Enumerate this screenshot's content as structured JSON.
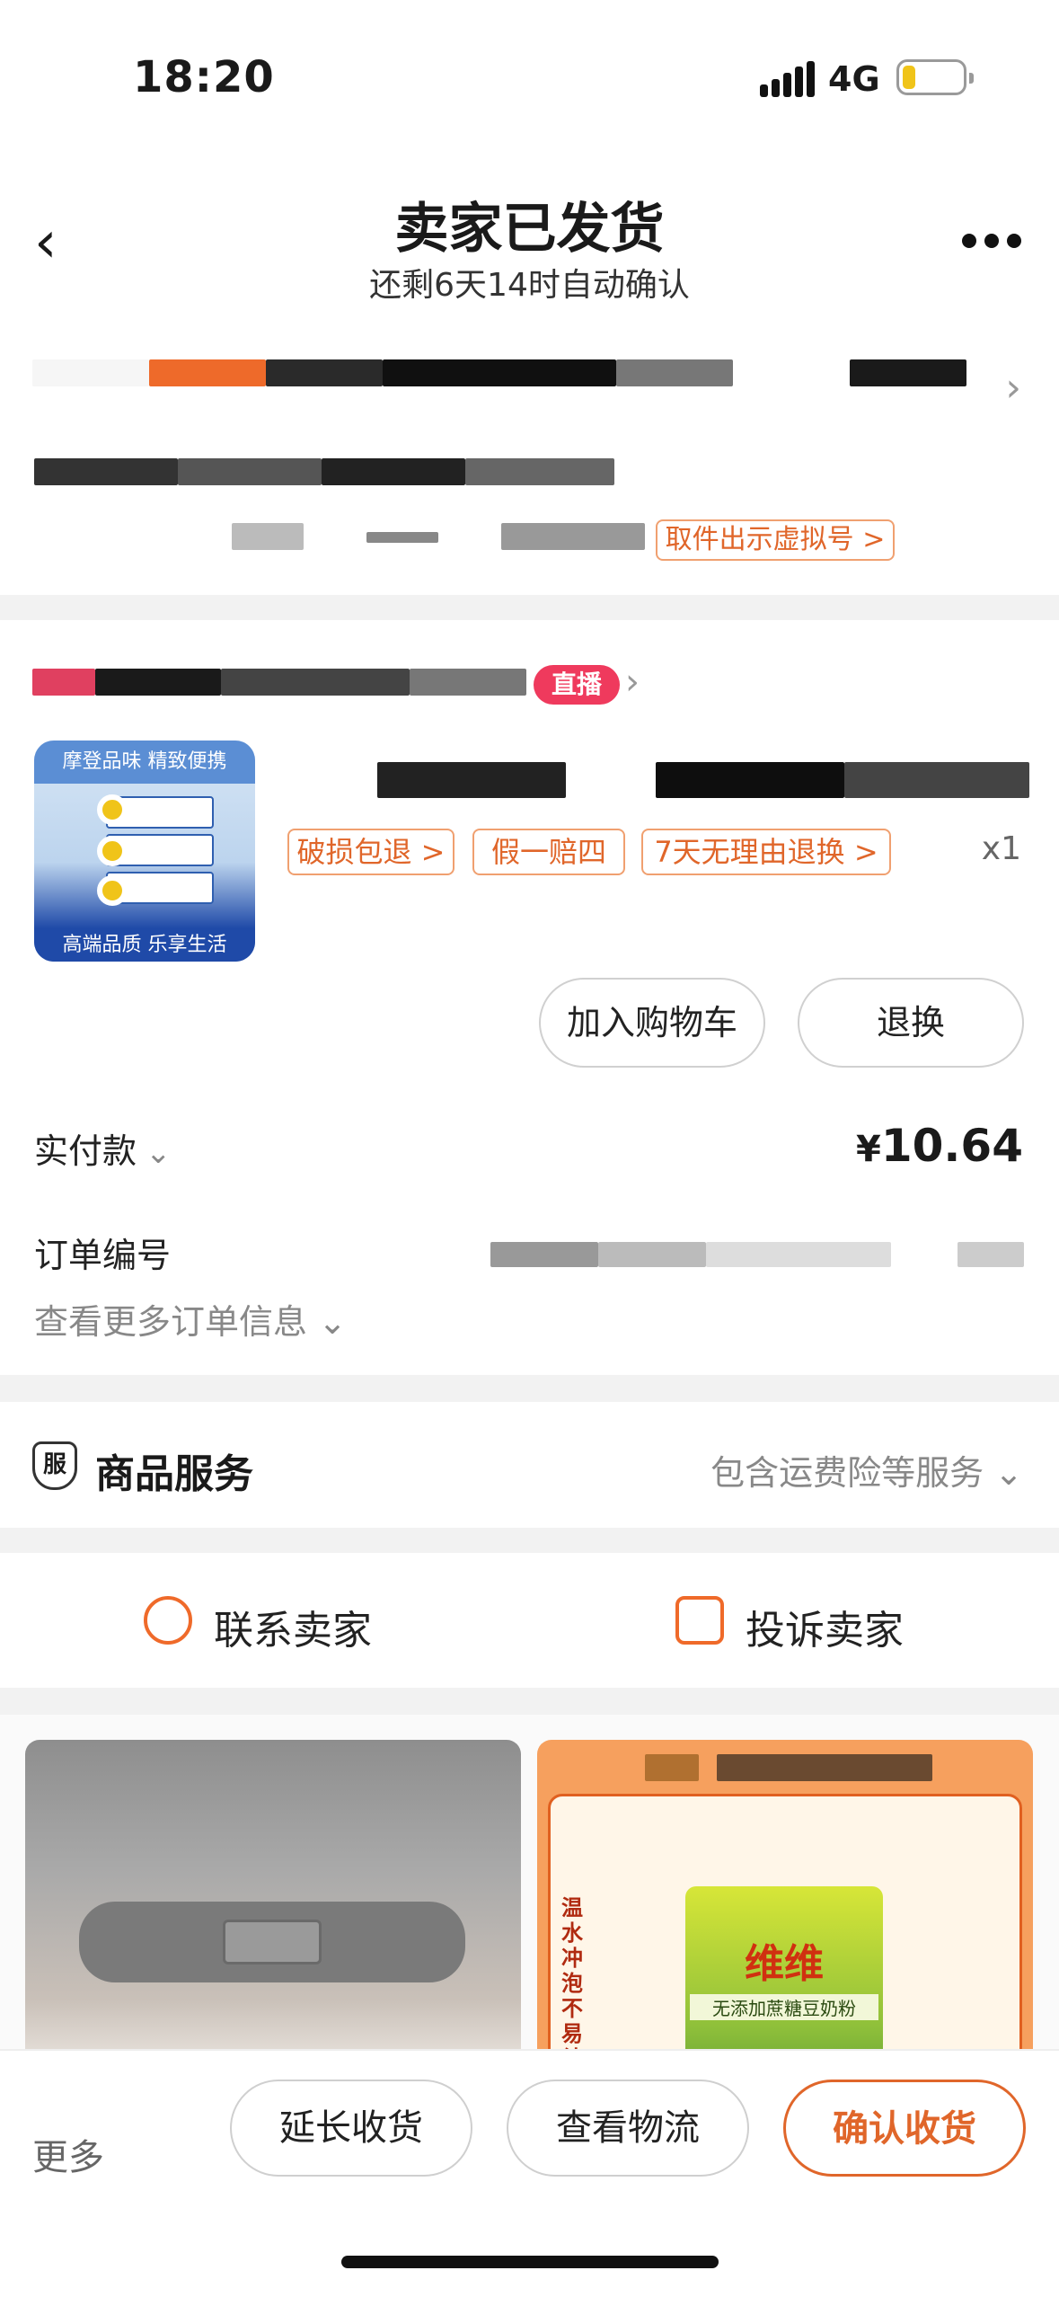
{
  "status_bar": {
    "time": "18:20",
    "network": "4G"
  },
  "header": {
    "title": "卖家已发货",
    "subtitle": "还剩6天14时自动确认"
  },
  "address": {
    "virtual_number_button": "取件出示虚拟号 >"
  },
  "shop": {
    "live_badge": "直播"
  },
  "product": {
    "image_banner": "摩登品味 精致便携",
    "image_footer": "高端品质 乐享生活",
    "tags": [
      "破损包退 >",
      "假一赔四",
      "7天无理由退换 >"
    ],
    "quantity": "x1",
    "add_to_cart": "加入购物车",
    "exchange": "退换"
  },
  "payment": {
    "label": "实付款",
    "currency": "¥",
    "amount": "10.64"
  },
  "order_number": {
    "label": "订单编号",
    "more_info": "查看更多订单信息"
  },
  "service": {
    "icon_text": "服",
    "label": "商品服务",
    "summary": "包含运费险等服务"
  },
  "contact": {
    "seller": "联系卖家",
    "complain": "投诉卖家"
  },
  "recommendations": {
    "item2_side_text": "温水冲泡不易结块",
    "item2_brand": "维维",
    "item2_sub": "无添加蔗糖豆奶粉"
  },
  "bottom_bar": {
    "more": "更多",
    "extend": "延长收货",
    "logistics": "查看物流",
    "confirm": "确认收货",
    "accent_color": "#e0662a"
  }
}
